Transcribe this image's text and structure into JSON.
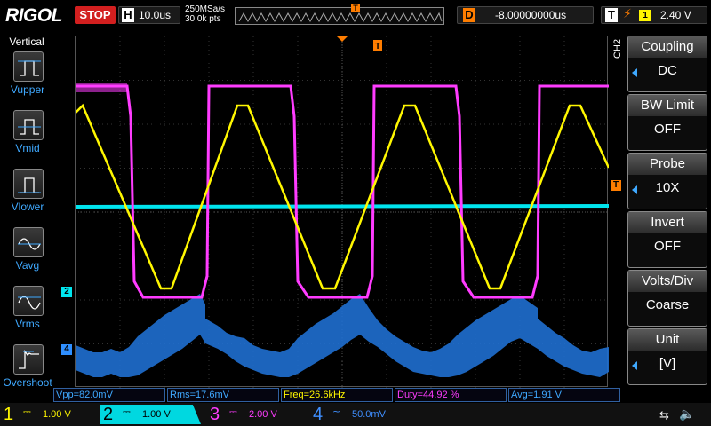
{
  "topbar": {
    "logo": "RIGOL",
    "run_state": "STOP",
    "h_letter": "H",
    "h_scale": "10.0us",
    "sample_rate": "250MSa/s",
    "memory_depth": "30.0k pts",
    "trig_marker": "T",
    "d_letter": "D",
    "delay": "-8.00000000us",
    "t_letter": "T",
    "trig_edge": "⚡",
    "trig_source": "1",
    "trig_level": "2.40 V"
  },
  "left_menu": {
    "title": "Vertical",
    "items": [
      {
        "label": "Vupper",
        "icon": "vupper-icon"
      },
      {
        "label": "Vmid",
        "icon": "vmid-icon"
      },
      {
        "label": "Vlower",
        "icon": "vlower-icon"
      },
      {
        "label": "Vavg",
        "icon": "vavg-icon"
      },
      {
        "label": "Vrms",
        "icon": "vrms-icon"
      },
      {
        "label": "Overshoot",
        "icon": "overshoot-icon"
      }
    ]
  },
  "right_menu": {
    "channel": "CH2",
    "items": [
      {
        "title": "Coupling",
        "value": "DC"
      },
      {
        "title": "BW Limit",
        "value": "OFF"
      },
      {
        "title": "Probe",
        "value": "10X"
      },
      {
        "title": "Invert",
        "value": "OFF"
      },
      {
        "title": "Volts/Div",
        "value": "Coarse"
      },
      {
        "title": "Unit",
        "value": "[V]"
      }
    ]
  },
  "screen": {
    "trig_pos_marker": "T",
    "trig_level_marker": "T",
    "ch2_marker": "2",
    "ch4_marker": "4"
  },
  "measurements": [
    {
      "text": "Vpp=82.0mV",
      "color": "#3fa9ff"
    },
    {
      "text": "Rms=17.6mV",
      "color": "#3fa9ff"
    },
    {
      "text": "Freq=26.6kHz",
      "color": "#fff700"
    },
    {
      "text": "Duty=44.92 %",
      "color": "#ff3cff"
    },
    {
      "text": "Avg=1.91 V",
      "color": "#3fa9ff"
    }
  ],
  "channels": [
    {
      "num": "1",
      "coupling": "⎓",
      "scale": "1.00 V",
      "color": "#fff700"
    },
    {
      "num": "2",
      "coupling": "⎓",
      "scale": "1.00 V",
      "color": "#00e5ee"
    },
    {
      "num": "3",
      "coupling": "⎓",
      "scale": "2.00 V",
      "color": "#ff3cff"
    },
    {
      "num": "4",
      "coupling": "~",
      "scale": "50.0mV",
      "color": "#3f8fff"
    }
  ],
  "status": {
    "usb": "⇆",
    "speaker": "🔈"
  },
  "colors": {
    "ch1": "#fff700",
    "ch2": "#00e5ee",
    "ch3": "#ff3cff",
    "ch4": "#2f8fff",
    "trigger": "#ff7d00",
    "accent": "#3fa9ff"
  }
}
